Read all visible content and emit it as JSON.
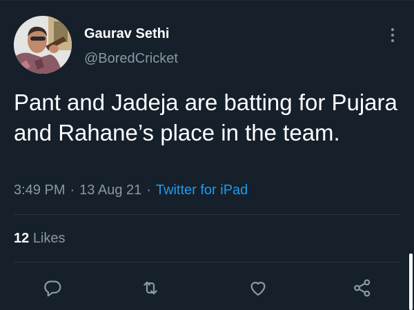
{
  "user": {
    "display_name": "Gaurav Sethi",
    "handle": "@BoredCricket",
    "avatar_icon": "profile-photo"
  },
  "tweet": {
    "text": "Pant and Jadeja are batting for Pujara and Rahane’s place in the team.",
    "time": "3:49 PM",
    "separator": "·",
    "date": "13 Aug 21",
    "source": "Twitter for iPad"
  },
  "stats": {
    "likes_count": "12",
    "likes_label": "Likes"
  },
  "actions": [
    "reply-icon",
    "retweet-icon",
    "like-icon",
    "share-icon"
  ],
  "colors": {
    "background": "#15202b",
    "primary_text": "#ffffff",
    "secondary_text": "#8b98a5",
    "accent": "#1d9bf0",
    "divider": "#2b3640"
  }
}
